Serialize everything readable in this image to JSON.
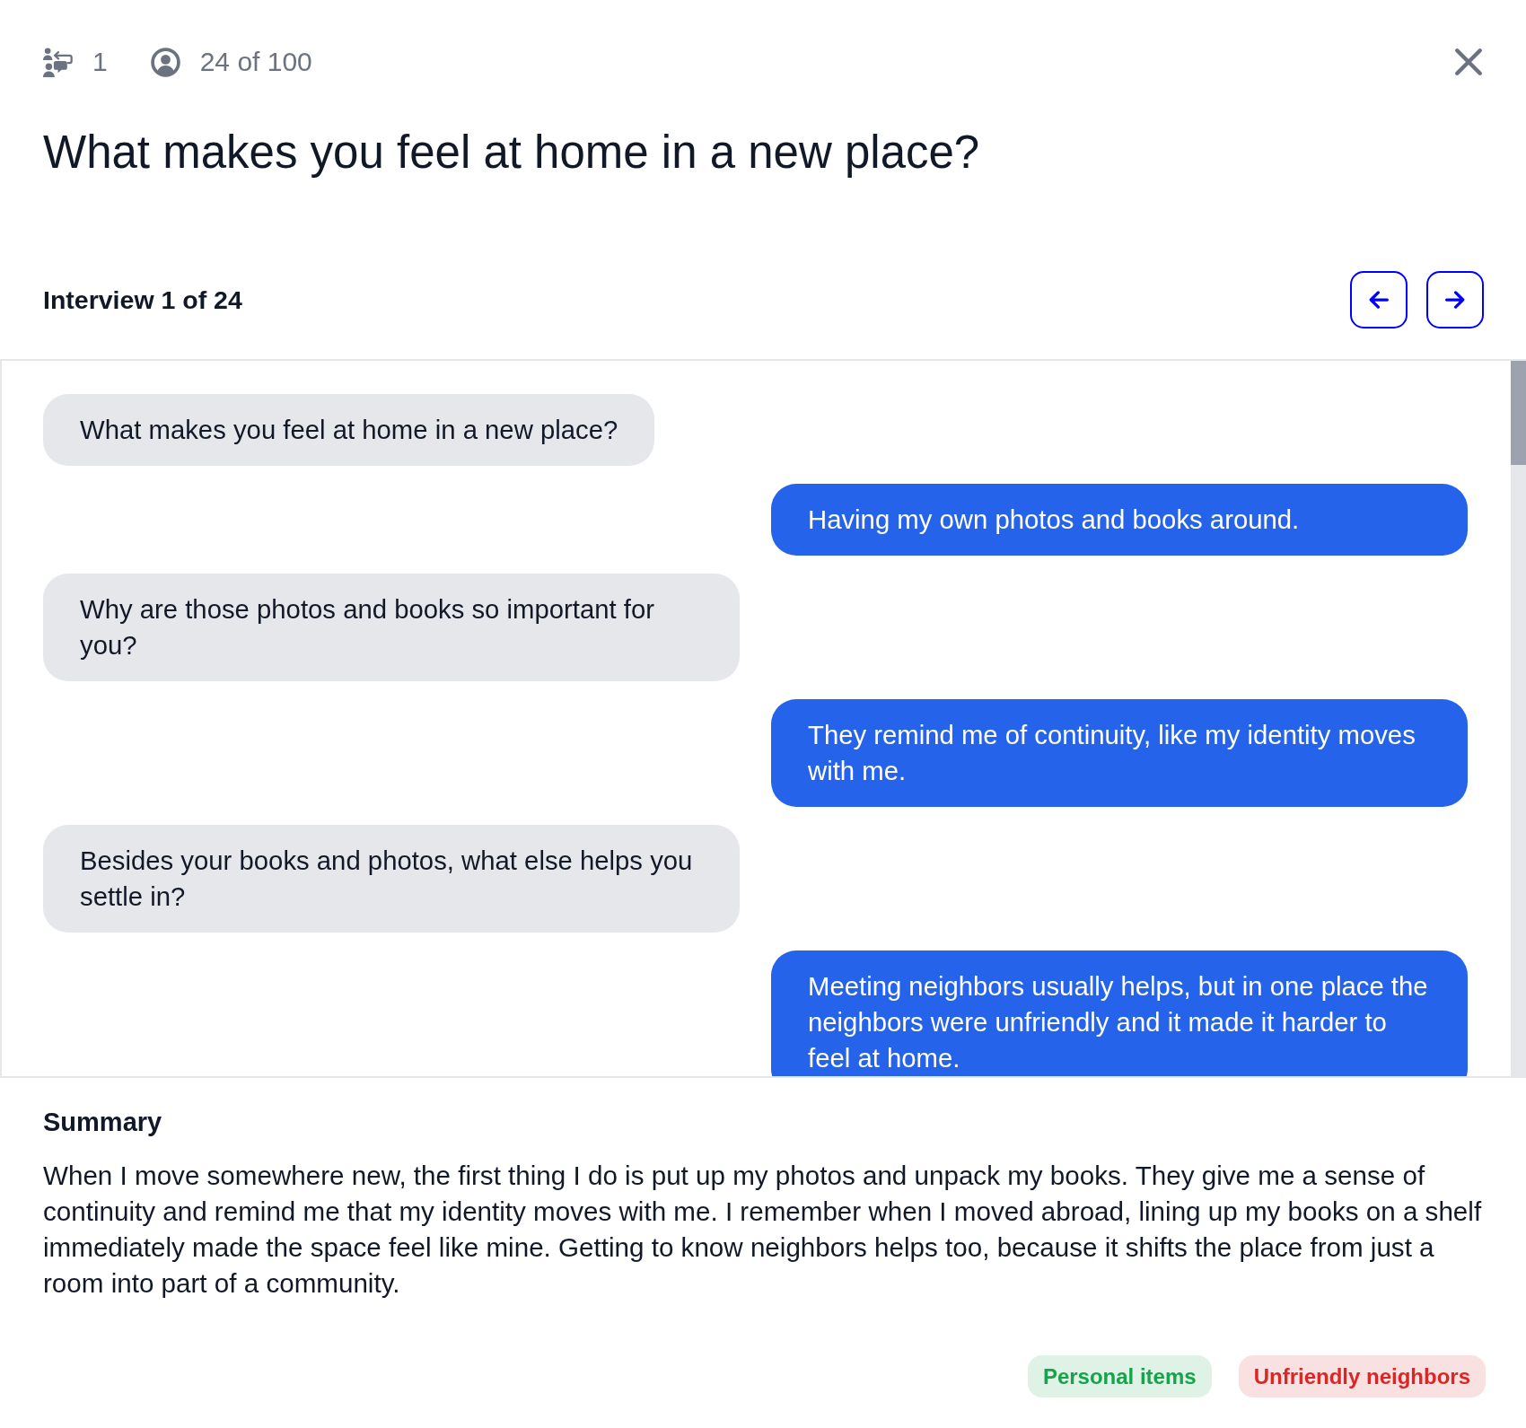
{
  "header": {
    "items": [
      {
        "kind": "conversations",
        "text": "1"
      },
      {
        "kind": "respondents",
        "text": "24 of 100"
      }
    ]
  },
  "title": "What makes you feel at home in a new place?",
  "interview": {
    "label": "Interview 1 of 24"
  },
  "messages": [
    {
      "kind": "question",
      "text": "What makes you feel at home in a new place?"
    },
    {
      "kind": "answer",
      "text": "Having my own photos and books around."
    },
    {
      "kind": "question",
      "text": "Why are those photos and books so important for you?"
    },
    {
      "kind": "answer",
      "text": "They remind me of continuity, like my identity moves with me."
    },
    {
      "kind": "question",
      "text": "Besides your books and photos, what else helps you settle in?"
    },
    {
      "kind": "answer",
      "text": "Meeting neighbors usually helps, but in one place the neighbors were unfriendly and it made it harder to feel at home."
    }
  ],
  "summary": {
    "heading": "Summary",
    "text": "When I move somewhere new, the first thing I do is put up my photos and unpack my books. They give me a sense of continuity and remind me that my identity moves with me. I remember when I moved abroad, lining up my books on a shelf immediately made the space feel like mine. Getting to know neighbors helps too, because it shifts the place from just a room into part of a community."
  },
  "tags": [
    {
      "label": "Personal items",
      "color": "#16a34a"
    },
    {
      "label": "Unfriendly neighbors",
      "color": "#dc2626"
    }
  ]
}
